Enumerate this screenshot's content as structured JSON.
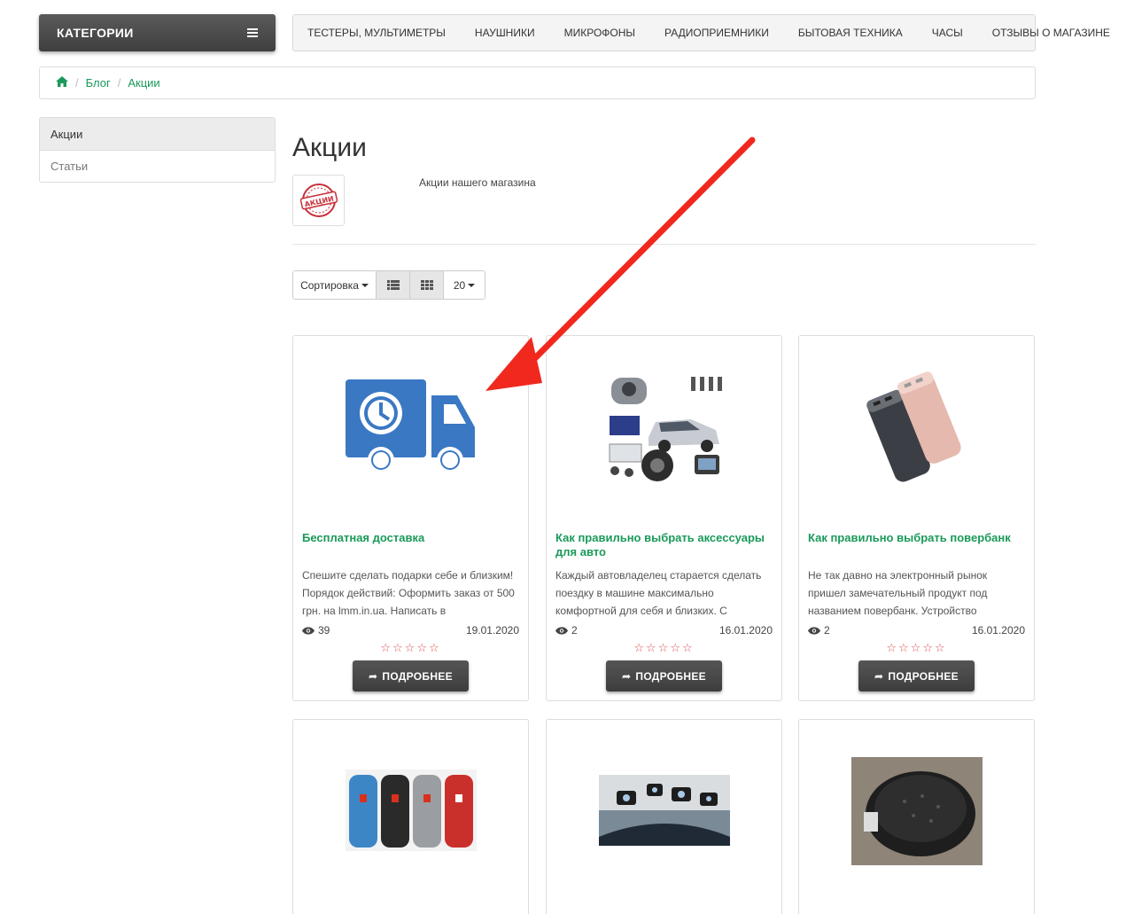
{
  "header": {
    "categories_label": "КАТЕГОРИИ",
    "nav": [
      "ТЕСТЕРЫ, МУЛЬТИМЕТРЫ",
      "НАУШНИКИ",
      "МИКРОФОНЫ",
      "РАДИОПРИЕМНИКИ",
      "БЫТОВАЯ ТЕХНИКА",
      "ЧАСЫ",
      "ОТЗЫВЫ О МАГАЗИНЕ"
    ]
  },
  "breadcrumb": [
    "Блог",
    "Акции"
  ],
  "sidebar": {
    "items": [
      "Акции",
      "Статьи"
    ]
  },
  "main": {
    "title": "Акции",
    "image_stamp": "АКЦИИ",
    "description": "Акции нашего магазина",
    "toolbar": {
      "sort_label": "Сортировка",
      "limit_value": "20"
    }
  },
  "cards": [
    {
      "title": "Бесплатная доставка",
      "text": "Спешите сделать подарки себе и близким! Порядок действий: Оформить заказ от 500 грн. на lmm.in.ua. Написать в",
      "views": "39",
      "date": "19.01.2020",
      "button": "ПОДРОБНЕЕ",
      "image": "delivery-truck-icon"
    },
    {
      "title": "Как правильно выбрать аксессуары для авто",
      "text": "Каждый автовладелец старается сделать поездку в машине максимально комфортной для себя и близких. С",
      "views": "2",
      "date": "16.01.2020",
      "button": "ПОДРОБНЕЕ",
      "image": "car-accessories-image"
    },
    {
      "title": "Как правильно выбрать повербанк",
      "text": "Не так давно на электронный рынок пришел замечательный продукт под названием повербанк. Устройство",
      "views": "2",
      "date": "16.01.2020",
      "button": "ПОДРОБНЕЕ",
      "image": "powerbank-image"
    }
  ],
  "cards_row2": [
    {
      "image": "speakers-image"
    },
    {
      "image": "dashcam-image"
    },
    {
      "image": "multicooker-image"
    }
  ],
  "rating": {
    "stars_filled": 0,
    "stars_total": 5
  },
  "colors": {
    "accent_green": "#1a9a5a",
    "dark_button": "#444444",
    "star_red": "#d9534f",
    "annotation_arrow": "#f0281e",
    "truck_blue": "#3a78c3"
  }
}
